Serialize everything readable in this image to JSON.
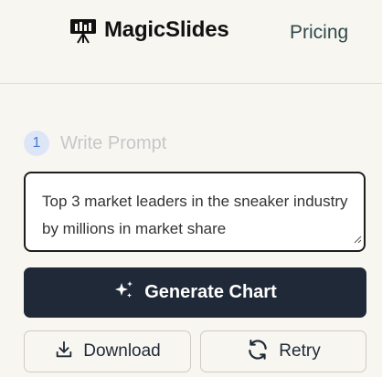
{
  "header": {
    "brand_name": "MagicSlides",
    "logo_icon": "presentation-board-icon",
    "nav_pricing": "Pricing"
  },
  "step": {
    "number": "1",
    "label": "Write Prompt"
  },
  "prompt": {
    "value": "Top 3 market leaders in the sneaker industry by millions in market share"
  },
  "actions": {
    "generate_label": "Generate Chart",
    "generate_icon": "sparkles-icon",
    "download_label": "Download",
    "download_icon": "download-icon",
    "retry_label": "Retry",
    "retry_icon": "refresh-icon"
  },
  "colors": {
    "background": "#f8f6f1",
    "primary_button": "#1f2937",
    "step_badge": "#dde6f7",
    "step_badge_text": "#4a79d8",
    "pricing_link": "#2e4a4a"
  }
}
